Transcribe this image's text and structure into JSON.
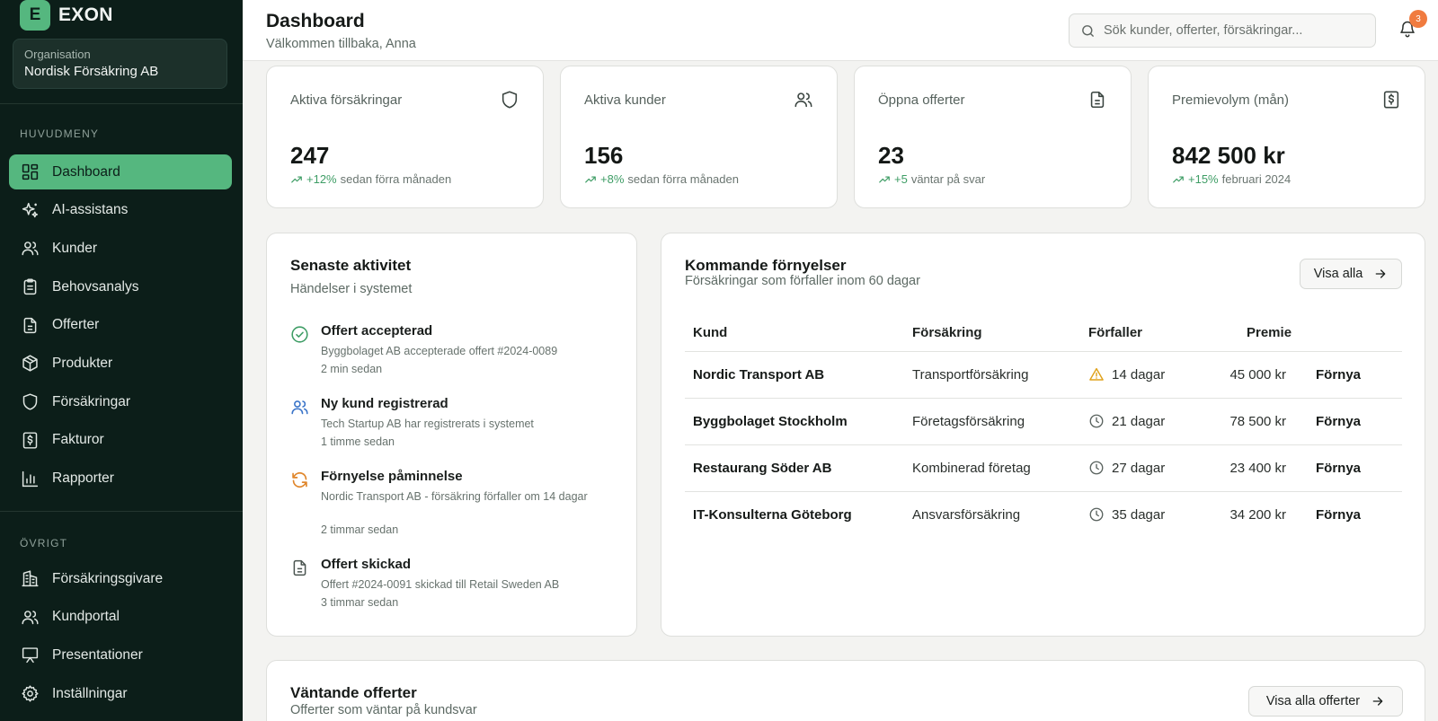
{
  "app": {
    "logo_letter": "E",
    "name": "EXON"
  },
  "organisation": {
    "label": "Organisation",
    "name": "Nordisk Försäkring AB"
  },
  "sidebar": {
    "main_label": "HUVUDMENY",
    "main_items": [
      {
        "label": "Dashboard",
        "icon": "dashboard-icon",
        "active": true
      },
      {
        "label": "AI-assistans",
        "icon": "sparkles-icon"
      },
      {
        "label": "Kunder",
        "icon": "users-icon"
      },
      {
        "label": "Behovsanalys",
        "icon": "clipboard-icon"
      },
      {
        "label": "Offerter",
        "icon": "document-icon"
      },
      {
        "label": "Produkter",
        "icon": "package-icon"
      },
      {
        "label": "Försäkringar",
        "icon": "shield-icon"
      },
      {
        "label": "Fakturor",
        "icon": "invoice-icon"
      },
      {
        "label": "Rapporter",
        "icon": "bar-chart-icon"
      }
    ],
    "other_label": "ÖVRIGT",
    "other_items": [
      {
        "label": "Försäkringsgivare",
        "icon": "building-icon"
      },
      {
        "label": "Kundportal",
        "icon": "user-portal-icon"
      },
      {
        "label": "Presentationer",
        "icon": "presentation-icon"
      },
      {
        "label": "Inställningar",
        "icon": "gear-icon"
      }
    ]
  },
  "header": {
    "title": "Dashboard",
    "subtitle": "Välkommen tillbaka, Anna",
    "search_placeholder": "Sök kunder, offerter, försäkringar...",
    "notification_count": "3"
  },
  "stats": [
    {
      "label": "Aktiva försäkringar",
      "value": "247",
      "change": "+12%",
      "note": "sedan förra månaden",
      "icon": "shield-icon"
    },
    {
      "label": "Aktiva kunder",
      "value": "156",
      "change": "+8%",
      "note": "sedan förra månaden",
      "icon": "users-icon"
    },
    {
      "label": "Öppna offerter",
      "value": "23",
      "change": "+5",
      "note": "väntar på svar",
      "icon": "document-icon"
    },
    {
      "label": "Premievolym (mån)",
      "value": "842 500 kr",
      "change": "+15%",
      "note": "februari 2024",
      "icon": "invoice-icon"
    }
  ],
  "activity": {
    "title": "Senaste aktivitet",
    "subtitle": "Händelser i systemet",
    "items": [
      {
        "title": "Offert accepterad",
        "desc": "Byggbolaget AB accepterade offert #2024-0089",
        "time": "2 min sedan",
        "icon": "check-circle-icon"
      },
      {
        "title": "Ny kund registrerad",
        "desc": "Tech Startup AB har registrerats i systemet",
        "time": "1 timme sedan",
        "icon": "users-icon"
      },
      {
        "title": "Förnyelse påminnelse",
        "desc": "Nordic Transport AB - försäkring förfaller om 14 dagar",
        "time": "2 timmar sedan",
        "icon": "refresh-icon"
      },
      {
        "title": "Offert skickad",
        "desc": "Offert #2024-0091 skickad till Retail Sweden AB",
        "time": "3 timmar sedan",
        "icon": "document-icon"
      }
    ]
  },
  "renewals": {
    "title": "Kommande förnyelser",
    "subtitle": "Försäkringar som förfaller inom 60 dagar",
    "view_all": "Visa alla",
    "columns": [
      "Kund",
      "Försäkring",
      "Förfaller",
      "Premie"
    ],
    "rows": [
      {
        "customer": "Nordic Transport AB",
        "insurance": "Transportförsäkring",
        "due": "14 dagar",
        "premium": "45 000 kr",
        "action": "Förnya",
        "icon": "warning-icon"
      },
      {
        "customer": "Byggbolaget Stockholm",
        "insurance": "Företagsförsäkring",
        "due": "21 dagar",
        "premium": "78 500 kr",
        "action": "Förnya",
        "icon": "clock-icon"
      },
      {
        "customer": "Restaurang Söder AB",
        "insurance": "Kombinerad företag",
        "due": "27 dagar",
        "premium": "23 400 kr",
        "action": "Förnya",
        "icon": "clock-icon"
      },
      {
        "customer": "IT-Konsulterna Göteborg",
        "insurance": "Ansvarsförsäkring",
        "due": "35 dagar",
        "premium": "34 200 kr",
        "action": "Förnya",
        "icon": "clock-icon"
      }
    ]
  },
  "pending": {
    "title": "Väntande offerter",
    "subtitle": "Offerter som väntar på kundsvar",
    "view_all": "Visa alla offerter"
  },
  "colors": {
    "sidebar_bg": "#0c1e19",
    "accent": "#55b77f",
    "trend_up": "#3e9d65",
    "warning": "#e0a21b",
    "badge": "#f07b3f"
  }
}
